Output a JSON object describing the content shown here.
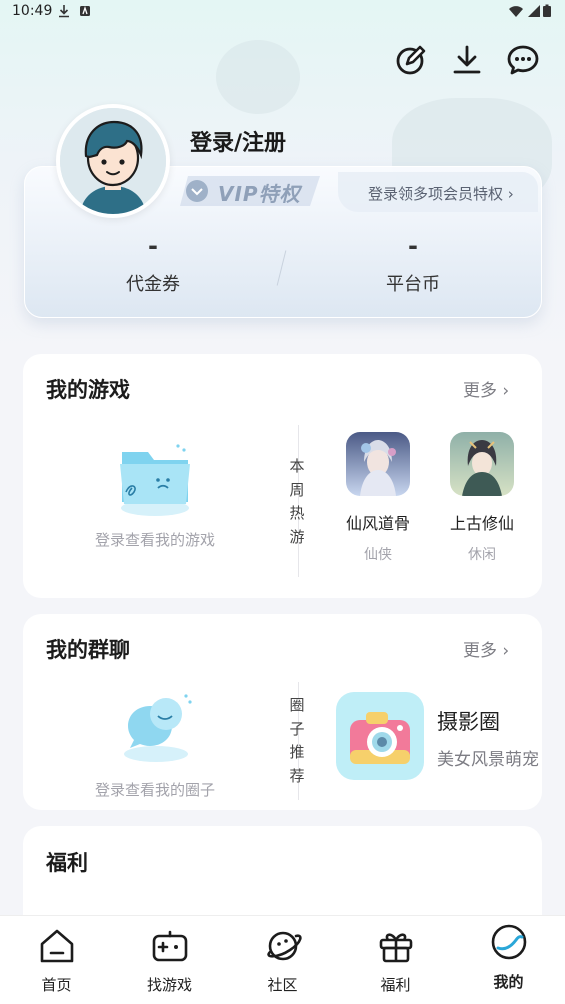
{
  "status_bar": {
    "time": "10:49"
  },
  "header": {
    "icons": [
      "edit-icon",
      "download-icon",
      "message-icon"
    ]
  },
  "profile": {
    "login_text": "登录/注册",
    "vip_label": "VIP特权",
    "vip_prompt": "登录领多项会员特权 ›",
    "stats": [
      {
        "value": "-",
        "label": "代金券"
      },
      {
        "value": "-",
        "label": "平台币"
      }
    ]
  },
  "my_games": {
    "title": "我的游戏",
    "more": "更多 ›",
    "empty_text": "登录查看我的游戏",
    "side_label": [
      "本",
      "周",
      "热",
      "游"
    ],
    "games": [
      {
        "name": "仙风道骨",
        "tag": "仙侠"
      },
      {
        "name": "上古修仙",
        "tag": "休闲"
      }
    ]
  },
  "my_groups": {
    "title": "我的群聊",
    "more": "更多 ›",
    "empty_text": "登录查看我的圈子",
    "side_label": [
      "圈",
      "子",
      "推",
      "荐"
    ],
    "circle": {
      "name": "摄影圈",
      "desc": "美女风景萌宠"
    }
  },
  "welfare": {
    "title": "福利"
  },
  "bottom_nav": {
    "items": [
      {
        "label": "首页",
        "icon": "home-icon"
      },
      {
        "label": "找游戏",
        "icon": "gamepad-icon"
      },
      {
        "label": "社区",
        "icon": "planet-icon"
      },
      {
        "label": "福利",
        "icon": "gift-icon"
      },
      {
        "label": "我的",
        "icon": "profile-icon"
      }
    ],
    "active": "我的"
  },
  "colors": {
    "accent": "#2aa7d8",
    "text": "#1c1c1c",
    "muted": "#a3a3ab"
  }
}
